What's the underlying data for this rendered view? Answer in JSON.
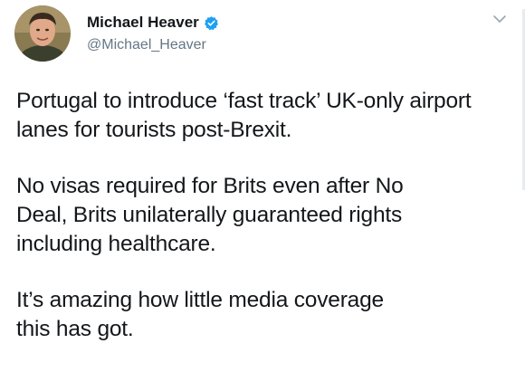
{
  "author": {
    "display_name": "Michael Heaver",
    "handle": "@Michael_Heaver",
    "verified": true
  },
  "icons": {
    "verified": "verified-badge-icon",
    "caret": "chevron-down-icon"
  },
  "colors": {
    "verified": "#1da1f2",
    "handle": "#657786",
    "text": "#14171a"
  },
  "tweet": {
    "paragraphs": [
      "Portugal to introduce ‘fast track’ UK-only airport\nlanes for tourists post-Brexit.",
      "No visas required for Brits even after No\nDeal, Brits unilaterally guaranteed rights\nincluding healthcare.",
      "It’s amazing how little media coverage\nthis has got."
    ]
  }
}
